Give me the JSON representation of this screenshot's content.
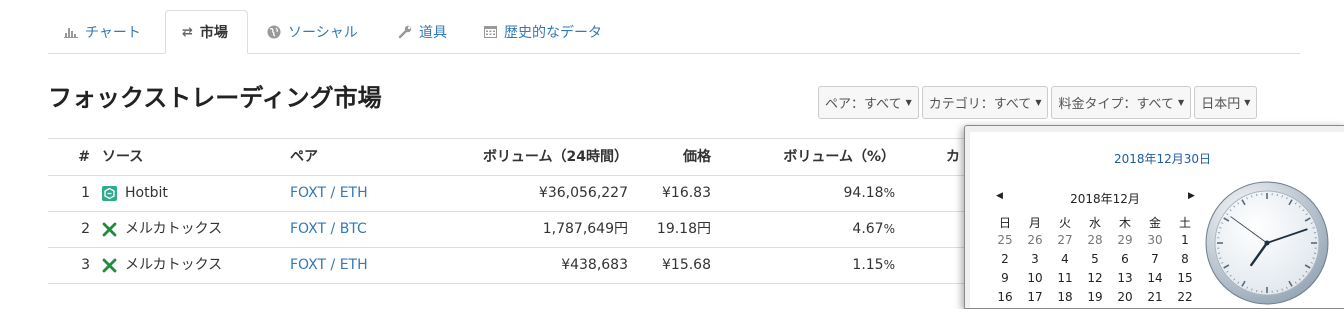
{
  "tabs": [
    {
      "label": "チャート",
      "icon": "bar-chart-icon"
    },
    {
      "label": "市場",
      "icon": "exchange-icon"
    },
    {
      "label": "ソーシャル",
      "icon": "globe-icon"
    },
    {
      "label": "道具",
      "icon": "wrench-icon"
    },
    {
      "label": "歴史的なデータ",
      "icon": "calendar-icon"
    }
  ],
  "page_title": "フォックストレーディング市場",
  "filters": {
    "pair": "ペア：すべて",
    "category": "カテゴリ：すべて",
    "fee_type": "料金タイプ：すべて",
    "currency": "日本円"
  },
  "table": {
    "headers": {
      "num": "#",
      "source": "ソース",
      "pair": "ペア",
      "volume": "ボリューム（24時間）",
      "price": "価格",
      "volume_pct": "ボリューム（%）",
      "category": "カ"
    },
    "rows": [
      {
        "num": "1",
        "source": "Hotbit",
        "logo": "hotbit-logo",
        "pair": "FOXT / ETH",
        "volume": "¥36,056,227",
        "price": "¥16.83",
        "pct": "94.18",
        "pct_sign": "%"
      },
      {
        "num": "2",
        "source": "メルカトックス",
        "logo": "mercatox-logo",
        "pair": "FOXT / BTC",
        "volume": "1,787,649円",
        "price": "19.18円",
        "pct": "4.67",
        "pct_sign": "%"
      },
      {
        "num": "3",
        "source": "メルカトックス",
        "logo": "mercatox-logo",
        "pair": "FOXT / ETH",
        "volume": "¥438,683",
        "price": "¥15.68",
        "pct": "1.15",
        "pct_sign": "%"
      }
    ]
  },
  "calendar": {
    "selected_date": "2018年12月30日",
    "month_label": "2018年12月",
    "prev": "◀",
    "next": "▶",
    "weekdays": [
      "日",
      "月",
      "火",
      "水",
      "木",
      "金",
      "土"
    ],
    "weeks": [
      [
        "25",
        "26",
        "27",
        "28",
        "29",
        "30",
        "1"
      ],
      [
        "2",
        "3",
        "4",
        "5",
        "6",
        "7",
        "8"
      ],
      [
        "9",
        "10",
        "11",
        "12",
        "13",
        "14",
        "15"
      ],
      [
        "16",
        "17",
        "18",
        "19",
        "20",
        "21",
        "22"
      ]
    ],
    "other_month_count": 6
  },
  "clock": {
    "hour": 7,
    "minute": 11,
    "second": 51
  }
}
